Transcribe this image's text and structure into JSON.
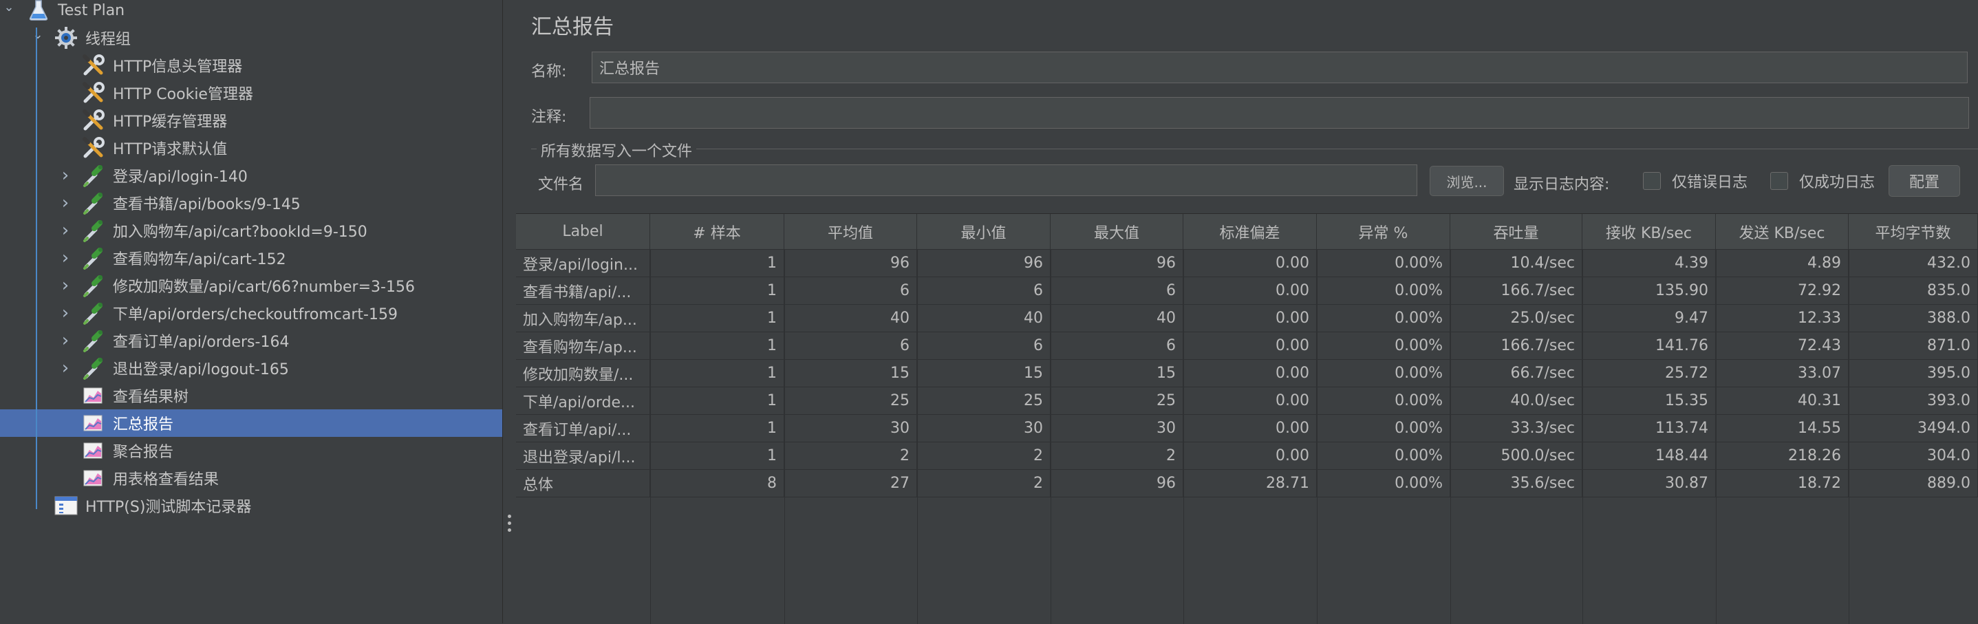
{
  "tree": {
    "items": [
      {
        "label": "Test Plan",
        "icon": "flask-icon",
        "arrow": "down"
      },
      {
        "label": "线程组",
        "icon": "gear-icon",
        "arrow": "down"
      },
      {
        "label": "HTTP信息头管理器",
        "icon": "wrench-icon",
        "arrow": ""
      },
      {
        "label": "HTTP Cookie管理器",
        "icon": "wrench-icon",
        "arrow": ""
      },
      {
        "label": "HTTP缓存管理器",
        "icon": "wrench-icon",
        "arrow": ""
      },
      {
        "label": "HTTP请求默认值",
        "icon": "wrench-icon",
        "arrow": ""
      },
      {
        "label": "登录/api/login-140",
        "icon": "pipette-icon",
        "arrow": "right"
      },
      {
        "label": "查看书籍/api/books/9-145",
        "icon": "pipette-icon",
        "arrow": "right"
      },
      {
        "label": "加入购物车/api/cart?bookId=9-150",
        "icon": "pipette-icon",
        "arrow": "right"
      },
      {
        "label": "查看购物车/api/cart-152",
        "icon": "pipette-icon",
        "arrow": "right"
      },
      {
        "label": "修改加购数量/api/cart/66?number=3-156",
        "icon": "pipette-icon",
        "arrow": "right"
      },
      {
        "label": "下单/api/orders/checkoutfromcart-159",
        "icon": "pipette-icon",
        "arrow": "right"
      },
      {
        "label": "查看订单/api/orders-164",
        "icon": "pipette-icon",
        "arrow": "right"
      },
      {
        "label": "退出登录/api/logout-165",
        "icon": "pipette-icon",
        "arrow": "right"
      },
      {
        "label": "查看结果树",
        "icon": "chart-icon",
        "arrow": ""
      },
      {
        "label": "汇总报告",
        "icon": "chart-icon",
        "arrow": "",
        "selected": true
      },
      {
        "label": "聚合报告",
        "icon": "chart-icon",
        "arrow": ""
      },
      {
        "label": "用表格查看结果",
        "icon": "chart-icon",
        "arrow": ""
      },
      {
        "label": "HTTP(S)测试脚本记录器",
        "icon": "recorder-icon",
        "arrow": ""
      }
    ]
  },
  "panel": {
    "title": "汇总报告",
    "name_label": "名称:",
    "name_value": "汇总报告",
    "comment_label": "注释:",
    "comment_value": "",
    "file_group_label": "所有数据写入一个文件",
    "file_label": "文件名",
    "file_value": "",
    "browse_button": "浏览...",
    "log_content_label": "显示日志内容:",
    "errors_only_label": "仅错误日志",
    "success_only_label": "仅成功日志",
    "config_button": "配置"
  },
  "table": {
    "headers": [
      "Label",
      "# 样本",
      "平均值",
      "最小值",
      "最大值",
      "标准偏差",
      "异常 %",
      "吞吐量",
      "接收 KB/sec",
      "发送 KB/sec",
      "平均字节数"
    ],
    "rows": [
      [
        "登录/api/login...",
        "1",
        "96",
        "96",
        "96",
        "0.00",
        "0.00%",
        "10.4/sec",
        "4.39",
        "4.89",
        "432.0"
      ],
      [
        "查看书籍/api/...",
        "1",
        "6",
        "6",
        "6",
        "0.00",
        "0.00%",
        "166.7/sec",
        "135.90",
        "72.92",
        "835.0"
      ],
      [
        "加入购物车/ap...",
        "1",
        "40",
        "40",
        "40",
        "0.00",
        "0.00%",
        "25.0/sec",
        "9.47",
        "12.33",
        "388.0"
      ],
      [
        "查看购物车/ap...",
        "1",
        "6",
        "6",
        "6",
        "0.00",
        "0.00%",
        "166.7/sec",
        "141.76",
        "72.43",
        "871.0"
      ],
      [
        "修改加购数量/...",
        "1",
        "15",
        "15",
        "15",
        "0.00",
        "0.00%",
        "66.7/sec",
        "25.72",
        "33.07",
        "395.0"
      ],
      [
        "下单/api/orde...",
        "1",
        "25",
        "25",
        "25",
        "0.00",
        "0.00%",
        "40.0/sec",
        "15.35",
        "40.31",
        "393.0"
      ],
      [
        "查看订单/api/...",
        "1",
        "30",
        "30",
        "30",
        "0.00",
        "0.00%",
        "33.3/sec",
        "113.74",
        "14.55",
        "3494.0"
      ],
      [
        "退出登录/api/l...",
        "1",
        "2",
        "2",
        "2",
        "0.00",
        "0.00%",
        "500.0/sec",
        "148.44",
        "218.26",
        "304.0"
      ],
      [
        "总体",
        "8",
        "27",
        "2",
        "96",
        "28.71",
        "0.00%",
        "35.6/sec",
        "30.87",
        "18.72",
        "889.0"
      ]
    ]
  },
  "colors": {
    "background": "#3c3f41",
    "selection": "#4b6eaf",
    "field": "#45494a"
  }
}
